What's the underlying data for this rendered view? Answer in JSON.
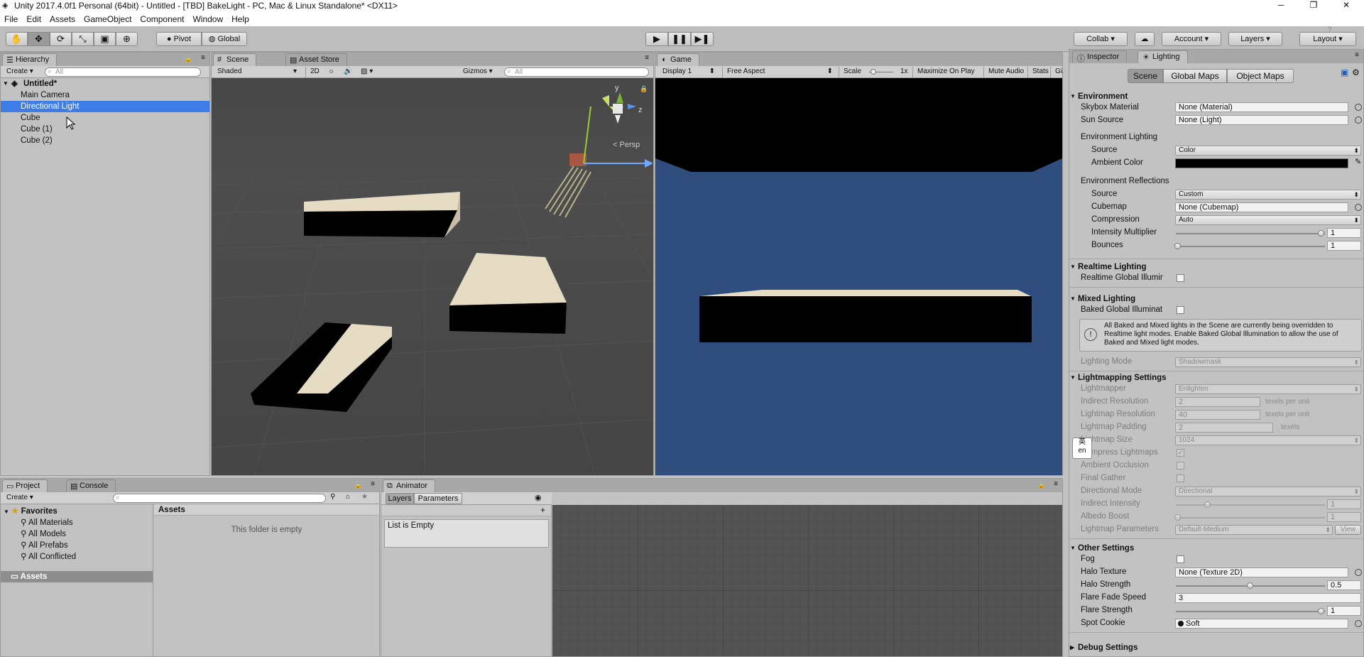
{
  "window": {
    "title": "Unity 2017.4.0f1 Personal (64bit) - Untitled - [TBD] BakeLight - PC, Mac & Linux Standalone* <DX11>",
    "controls": [
      "─",
      "❐",
      "✕"
    ]
  },
  "menu": [
    "File",
    "Edit",
    "Assets",
    "GameObject",
    "Component",
    "Window",
    "Help"
  ],
  "toolbar": {
    "pivot": "Pivot",
    "global": "Global",
    "collab": "Collab",
    "account": "Account",
    "layers": "Layers",
    "layout": "Layout",
    "help_mark": "?"
  },
  "hierarchy": {
    "tab": "Hierarchy",
    "create": "Create",
    "search_placeholder": "All",
    "scene": "Untitled*",
    "items": [
      "Main Camera",
      "Directional Light",
      "Cube",
      "Cube (1)",
      "Cube (2)"
    ],
    "selected_index": 1
  },
  "scene_view": {
    "tabs": [
      "Scene",
      "Asset Store"
    ],
    "shading": "Shaded",
    "mode_2d": "2D",
    "gizmos": "Gizmos",
    "search_placeholder": "All",
    "gizmo_axes": {
      "y": "y",
      "z": "z",
      "persp": "Persp"
    }
  },
  "game_view": {
    "tab": "Game",
    "display": "Display 1",
    "aspect": "Free Aspect",
    "scale_label": "Scale",
    "scale_value": "1x",
    "maximize": "Maximize On Play",
    "mute": "Mute Audio",
    "stats": "Stats",
    "gizmos": "Gizmos",
    "sky_color": "#2f4e7d"
  },
  "inspector": {
    "tabs": [
      "Inspector",
      "Lighting"
    ],
    "subtabs": [
      "Scene",
      "Global Maps",
      "Object Maps"
    ],
    "environment": {
      "title": "Environment",
      "skybox_label": "Skybox Material",
      "skybox_value": "None (Material)",
      "sun_label": "Sun Source",
      "sun_value": "None (Light)",
      "env_lighting": "Environment Lighting",
      "source_label": "Source",
      "source_value": "Color",
      "ambient_label": "Ambient Color",
      "env_reflections": "Environment Reflections",
      "refl_source_label": "Source",
      "refl_source_value": "Custom",
      "cubemap_label": "Cubemap",
      "cubemap_value": "None (Cubemap)",
      "compression_label": "Compression",
      "compression_value": "Auto",
      "intensity_label": "Intensity Multiplier",
      "intensity_value": "1",
      "bounces_label": "Bounces",
      "bounces_value": "1"
    },
    "realtime": {
      "title": "Realtime Lighting",
      "gi_label": "Realtime Global Illumir"
    },
    "mixed": {
      "title": "Mixed Lighting",
      "baked_label": "Baked Global Illuminat",
      "warning": "All Baked and Mixed lights in the Scene are currently being overridden to Realtime light modes. Enable Baked Global Illumination to allow the use of Baked and Mixed light modes.",
      "mode_label": "Lighting Mode",
      "mode_value": "Shadowmask"
    },
    "lightmapping": {
      "title": "Lightmapping Settings",
      "lightmapper_label": "Lightmapper",
      "lightmapper_value": "Enlighten",
      "indirect_res_label": "Indirect Resolution",
      "indirect_res_value": "2",
      "indirect_res_unit": "texels per unit",
      "lm_res_label": "Lightmap Resolution",
      "lm_res_value": "40",
      "lm_res_unit": "texels per unit",
      "padding_label": "Lightmap Padding",
      "padding_value": "2",
      "padding_unit": "texels",
      "size_label": "Lightmap Size",
      "size_value": "1024",
      "compress_label": "Compress Lightmaps",
      "ao_label": "Ambient Occlusion",
      "fg_label": "Final Gather",
      "dir_label": "Directional Mode",
      "dir_value": "Directional",
      "ind_int_label": "Indirect Intensity",
      "ind_int_value": "1",
      "albedo_label": "Albedo Boost",
      "albedo_value": "1",
      "params_label": "Lightmap Parameters",
      "params_value": "Default-Medium",
      "view": "View"
    },
    "other": {
      "title": "Other Settings",
      "fog_label": "Fog",
      "halo_tex_label": "Halo Texture",
      "halo_tex_value": "None (Texture 2D)",
      "halo_str_label": "Halo Strength",
      "halo_str_value": "0.5",
      "flare_fade_label": "Flare Fade Speed",
      "flare_fade_value": "3",
      "flare_str_label": "Flare Strength",
      "flare_str_value": "1",
      "cookie_label": "Spot Cookie",
      "cookie_value": "Soft"
    },
    "debug": {
      "title": "Debug Settings"
    },
    "ime_badge": {
      "top": "英",
      "bottom": "en"
    }
  },
  "project": {
    "tabs": [
      "Project",
      "Console"
    ],
    "create": "Create",
    "favorites": "Favorites",
    "fav_items": [
      "All Materials",
      "All Models",
      "All Prefabs",
      "All Conflicted"
    ],
    "assets_root": "Assets",
    "assets_header": "Assets",
    "empty": "This folder is empty"
  },
  "animator": {
    "tab": "Animator",
    "subtabs": [
      "Layers",
      "Parameters"
    ],
    "list_empty": "List is Empty"
  }
}
